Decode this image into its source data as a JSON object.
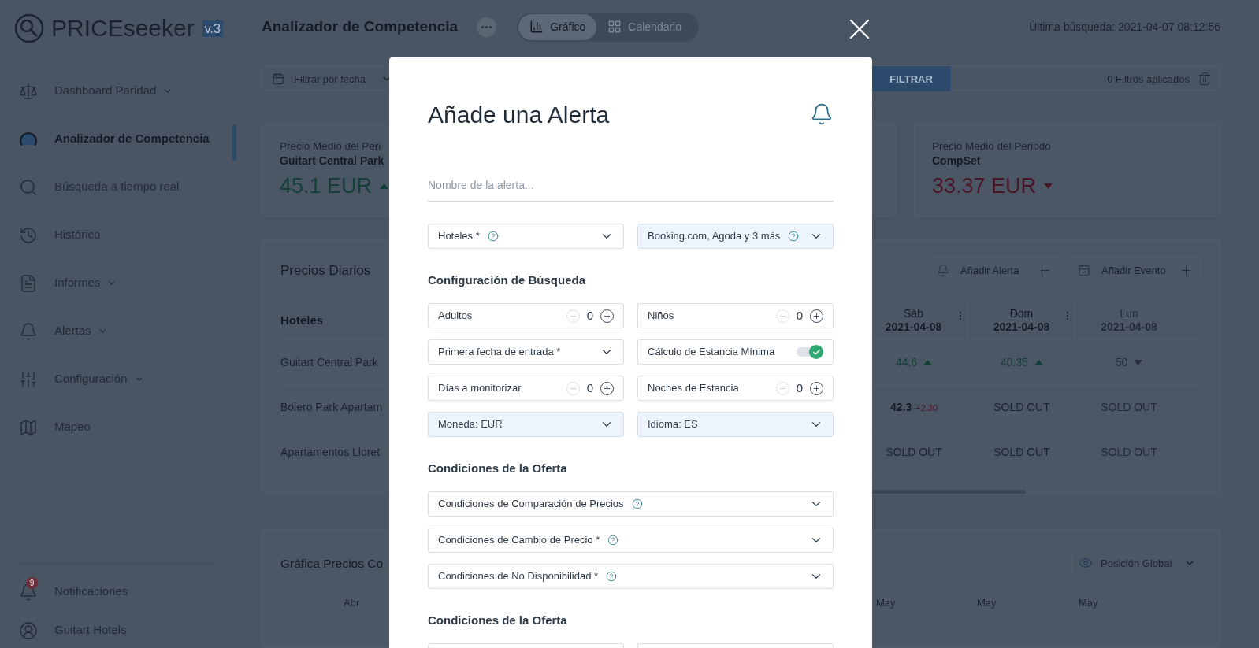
{
  "logo": {
    "brand_bold": "PRICE",
    "brand_light": "seeker",
    "version": "v.3"
  },
  "sidebar": {
    "items": [
      {
        "label": "Dashboard Paridad",
        "expandable": true,
        "selected": false
      },
      {
        "label": "Analizador de Competencia",
        "expandable": false,
        "selected": true
      },
      {
        "label": "Búsqueda a tiempo real",
        "expandable": false,
        "selected": false
      },
      {
        "label": "Histórico",
        "expandable": false,
        "selected": false
      },
      {
        "label": "Informes",
        "expandable": true,
        "selected": false
      },
      {
        "label": "Alertas",
        "expandable": true,
        "selected": false
      },
      {
        "label": "Configuración",
        "expandable": true,
        "selected": false
      },
      {
        "label": "Mapeo",
        "expandable": false,
        "selected": false
      }
    ],
    "notifications": {
      "label": "Notificaciones",
      "badge": "9"
    },
    "account": {
      "label": "Guitart Hotels"
    }
  },
  "header": {
    "title": "Analizador de Competencia",
    "view_tabs": [
      {
        "label": "Gráfico",
        "selected": true
      },
      {
        "label": "Calendario",
        "selected": false
      }
    ],
    "last_search": "Última búsqueda: 2021-04-07 08:12:56"
  },
  "filter_bar": {
    "date_filter": "Filtrar por fecha",
    "filter_button": "FILTRAR",
    "applied": "0 Filtros aplicados"
  },
  "stat_cards": [
    {
      "label": "Precio Medio del Peri",
      "subject": "Guitart Central Park",
      "value": "45.1 EUR",
      "rising": true
    },
    {
      "label": "Precio Medio del Periodo",
      "subject": "CompSet",
      "value": "33.37 EUR",
      "rising": false
    }
  ],
  "daily_prices": {
    "title": "Precios Diarios",
    "actions": [
      "Añadir Alerta",
      "Añadir Evento"
    ],
    "hotel_header": "Hoteles",
    "columns": [
      {
        "day": "Sáb",
        "date": "2021-04-08",
        "faded": false
      },
      {
        "day": "Dom",
        "date": "2021-04-08",
        "faded": false
      },
      {
        "day": "Lun",
        "date": "2021-04-08",
        "faded": true
      }
    ],
    "rows": [
      {
        "hotel": "Guitart Central Park",
        "cells": [
          {
            "kind": "price",
            "value": "44.6",
            "rising": true
          },
          {
            "kind": "price",
            "value": "40.35",
            "rising": true
          },
          {
            "kind": "price",
            "value": "50",
            "rising": false
          }
        ]
      },
      {
        "hotel": "Bolero Park Apartam",
        "cells": [
          {
            "kind": "delta",
            "value": "42.3",
            "delta": "+2.30"
          },
          {
            "kind": "sold_out",
            "value": "SOLD OUT"
          },
          {
            "kind": "sold_out",
            "value": "SOLD OUT"
          }
        ]
      },
      {
        "hotel": "Apartamentos Lloret",
        "cells": [
          {
            "kind": "sold_out",
            "value": "SOLD OUT"
          },
          {
            "kind": "sold_out",
            "value": "SOLD OUT"
          },
          {
            "kind": "sold_out",
            "value": "SOLD OUT"
          }
        ]
      }
    ]
  },
  "price_chart": {
    "title": "Gráfica Precios Co",
    "selector": "Posición Global",
    "axis_labels": [
      "Abr",
      "May",
      "May",
      "May"
    ]
  },
  "modal": {
    "title": "Añade una Alerta",
    "name_placeholder": "Nombre de la alerta...",
    "blocks": [
      {
        "kind": "row",
        "fields": [
          {
            "kind": "select",
            "label": "Hoteles *",
            "help": true,
            "filled": false
          },
          {
            "kind": "select",
            "label": "Booking.com, Agoda y 3 más",
            "help": true,
            "filled": true
          }
        ]
      },
      {
        "kind": "heading",
        "text": "Configuración de Búsqueda"
      },
      {
        "kind": "row",
        "fields": [
          {
            "kind": "stepper",
            "label": "Adultos",
            "value": "0"
          },
          {
            "kind": "stepper",
            "label": "Niños",
            "value": "0"
          }
        ]
      },
      {
        "kind": "row",
        "fields": [
          {
            "kind": "select",
            "label": "Primera fecha de entrada *",
            "help": false,
            "filled": false
          },
          {
            "kind": "toggle",
            "label": "Cálculo de Estancia Mínima",
            "on": true
          }
        ]
      },
      {
        "kind": "row",
        "fields": [
          {
            "kind": "stepper",
            "label": "Días a monitorizar",
            "value": "0"
          },
          {
            "kind": "stepper",
            "label": "Noches de Estancia",
            "value": "0"
          }
        ]
      },
      {
        "kind": "row",
        "fields": [
          {
            "kind": "select",
            "label": "Moneda: EUR",
            "help": false,
            "filled": true
          },
          {
            "kind": "select",
            "label": "Idioma: ES",
            "help": false,
            "filled": true
          }
        ]
      },
      {
        "kind": "heading",
        "text": "Condiciones de la Oferta"
      },
      {
        "kind": "row",
        "fields": [
          {
            "kind": "select",
            "label": "Condiciones de Comparación de Precios",
            "help": true,
            "filled": false
          }
        ]
      },
      {
        "kind": "row",
        "fields": [
          {
            "kind": "select",
            "label": "Condiciones de Cambio de Precio *",
            "help": true,
            "filled": false
          }
        ]
      },
      {
        "kind": "row",
        "fields": [
          {
            "kind": "select",
            "label": "Condiciones de No Disponibilidad *",
            "help": true,
            "filled": false
          }
        ]
      },
      {
        "kind": "heading",
        "text": "Condiciones de la Oferta"
      },
      {
        "kind": "row",
        "fields": [
          {
            "kind": "blank"
          },
          {
            "kind": "blank"
          }
        ]
      }
    ]
  }
}
